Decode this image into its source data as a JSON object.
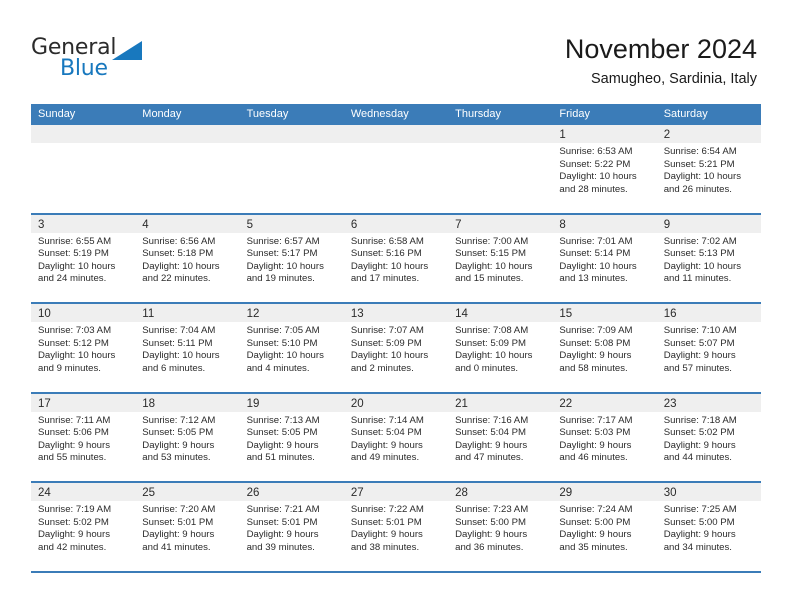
{
  "brand": {
    "name_part1": "General",
    "name_part2": "Blue",
    "triangle_color": "#1878be",
    "accent_color": "#3b7cb8"
  },
  "header": {
    "title": "November 2024",
    "subtitle": "Samugheo, Sardinia, Italy"
  },
  "weekdays": [
    "Sunday",
    "Monday",
    "Tuesday",
    "Wednesday",
    "Thursday",
    "Friday",
    "Saturday"
  ],
  "weeks": [
    [
      {
        "day": "",
        "sunrise": "",
        "sunset": "",
        "daylight1": "",
        "daylight2": ""
      },
      {
        "day": "",
        "sunrise": "",
        "sunset": "",
        "daylight1": "",
        "daylight2": ""
      },
      {
        "day": "",
        "sunrise": "",
        "sunset": "",
        "daylight1": "",
        "daylight2": ""
      },
      {
        "day": "",
        "sunrise": "",
        "sunset": "",
        "daylight1": "",
        "daylight2": ""
      },
      {
        "day": "",
        "sunrise": "",
        "sunset": "",
        "daylight1": "",
        "daylight2": ""
      },
      {
        "day": "1",
        "sunrise": "Sunrise: 6:53 AM",
        "sunset": "Sunset: 5:22 PM",
        "daylight1": "Daylight: 10 hours",
        "daylight2": "and 28 minutes."
      },
      {
        "day": "2",
        "sunrise": "Sunrise: 6:54 AM",
        "sunset": "Sunset: 5:21 PM",
        "daylight1": "Daylight: 10 hours",
        "daylight2": "and 26 minutes."
      }
    ],
    [
      {
        "day": "3",
        "sunrise": "Sunrise: 6:55 AM",
        "sunset": "Sunset: 5:19 PM",
        "daylight1": "Daylight: 10 hours",
        "daylight2": "and 24 minutes."
      },
      {
        "day": "4",
        "sunrise": "Sunrise: 6:56 AM",
        "sunset": "Sunset: 5:18 PM",
        "daylight1": "Daylight: 10 hours",
        "daylight2": "and 22 minutes."
      },
      {
        "day": "5",
        "sunrise": "Sunrise: 6:57 AM",
        "sunset": "Sunset: 5:17 PM",
        "daylight1": "Daylight: 10 hours",
        "daylight2": "and 19 minutes."
      },
      {
        "day": "6",
        "sunrise": "Sunrise: 6:58 AM",
        "sunset": "Sunset: 5:16 PM",
        "daylight1": "Daylight: 10 hours",
        "daylight2": "and 17 minutes."
      },
      {
        "day": "7",
        "sunrise": "Sunrise: 7:00 AM",
        "sunset": "Sunset: 5:15 PM",
        "daylight1": "Daylight: 10 hours",
        "daylight2": "and 15 minutes."
      },
      {
        "day": "8",
        "sunrise": "Sunrise: 7:01 AM",
        "sunset": "Sunset: 5:14 PM",
        "daylight1": "Daylight: 10 hours",
        "daylight2": "and 13 minutes."
      },
      {
        "day": "9",
        "sunrise": "Sunrise: 7:02 AM",
        "sunset": "Sunset: 5:13 PM",
        "daylight1": "Daylight: 10 hours",
        "daylight2": "and 11 minutes."
      }
    ],
    [
      {
        "day": "10",
        "sunrise": "Sunrise: 7:03 AM",
        "sunset": "Sunset: 5:12 PM",
        "daylight1": "Daylight: 10 hours",
        "daylight2": "and 9 minutes."
      },
      {
        "day": "11",
        "sunrise": "Sunrise: 7:04 AM",
        "sunset": "Sunset: 5:11 PM",
        "daylight1": "Daylight: 10 hours",
        "daylight2": "and 6 minutes."
      },
      {
        "day": "12",
        "sunrise": "Sunrise: 7:05 AM",
        "sunset": "Sunset: 5:10 PM",
        "daylight1": "Daylight: 10 hours",
        "daylight2": "and 4 minutes."
      },
      {
        "day": "13",
        "sunrise": "Sunrise: 7:07 AM",
        "sunset": "Sunset: 5:09 PM",
        "daylight1": "Daylight: 10 hours",
        "daylight2": "and 2 minutes."
      },
      {
        "day": "14",
        "sunrise": "Sunrise: 7:08 AM",
        "sunset": "Sunset: 5:09 PM",
        "daylight1": "Daylight: 10 hours",
        "daylight2": "and 0 minutes."
      },
      {
        "day": "15",
        "sunrise": "Sunrise: 7:09 AM",
        "sunset": "Sunset: 5:08 PM",
        "daylight1": "Daylight: 9 hours",
        "daylight2": "and 58 minutes."
      },
      {
        "day": "16",
        "sunrise": "Sunrise: 7:10 AM",
        "sunset": "Sunset: 5:07 PM",
        "daylight1": "Daylight: 9 hours",
        "daylight2": "and 57 minutes."
      }
    ],
    [
      {
        "day": "17",
        "sunrise": "Sunrise: 7:11 AM",
        "sunset": "Sunset: 5:06 PM",
        "daylight1": "Daylight: 9 hours",
        "daylight2": "and 55 minutes."
      },
      {
        "day": "18",
        "sunrise": "Sunrise: 7:12 AM",
        "sunset": "Sunset: 5:05 PM",
        "daylight1": "Daylight: 9 hours",
        "daylight2": "and 53 minutes."
      },
      {
        "day": "19",
        "sunrise": "Sunrise: 7:13 AM",
        "sunset": "Sunset: 5:05 PM",
        "daylight1": "Daylight: 9 hours",
        "daylight2": "and 51 minutes."
      },
      {
        "day": "20",
        "sunrise": "Sunrise: 7:14 AM",
        "sunset": "Sunset: 5:04 PM",
        "daylight1": "Daylight: 9 hours",
        "daylight2": "and 49 minutes."
      },
      {
        "day": "21",
        "sunrise": "Sunrise: 7:16 AM",
        "sunset": "Sunset: 5:04 PM",
        "daylight1": "Daylight: 9 hours",
        "daylight2": "and 47 minutes."
      },
      {
        "day": "22",
        "sunrise": "Sunrise: 7:17 AM",
        "sunset": "Sunset: 5:03 PM",
        "daylight1": "Daylight: 9 hours",
        "daylight2": "and 46 minutes."
      },
      {
        "day": "23",
        "sunrise": "Sunrise: 7:18 AM",
        "sunset": "Sunset: 5:02 PM",
        "daylight1": "Daylight: 9 hours",
        "daylight2": "and 44 minutes."
      }
    ],
    [
      {
        "day": "24",
        "sunrise": "Sunrise: 7:19 AM",
        "sunset": "Sunset: 5:02 PM",
        "daylight1": "Daylight: 9 hours",
        "daylight2": "and 42 minutes."
      },
      {
        "day": "25",
        "sunrise": "Sunrise: 7:20 AM",
        "sunset": "Sunset: 5:01 PM",
        "daylight1": "Daylight: 9 hours",
        "daylight2": "and 41 minutes."
      },
      {
        "day": "26",
        "sunrise": "Sunrise: 7:21 AM",
        "sunset": "Sunset: 5:01 PM",
        "daylight1": "Daylight: 9 hours",
        "daylight2": "and 39 minutes."
      },
      {
        "day": "27",
        "sunrise": "Sunrise: 7:22 AM",
        "sunset": "Sunset: 5:01 PM",
        "daylight1": "Daylight: 9 hours",
        "daylight2": "and 38 minutes."
      },
      {
        "day": "28",
        "sunrise": "Sunrise: 7:23 AM",
        "sunset": "Sunset: 5:00 PM",
        "daylight1": "Daylight: 9 hours",
        "daylight2": "and 36 minutes."
      },
      {
        "day": "29",
        "sunrise": "Sunrise: 7:24 AM",
        "sunset": "Sunset: 5:00 PM",
        "daylight1": "Daylight: 9 hours",
        "daylight2": "and 35 minutes."
      },
      {
        "day": "30",
        "sunrise": "Sunrise: 7:25 AM",
        "sunset": "Sunset: 5:00 PM",
        "daylight1": "Daylight: 9 hours",
        "daylight2": "and 34 minutes."
      }
    ]
  ]
}
